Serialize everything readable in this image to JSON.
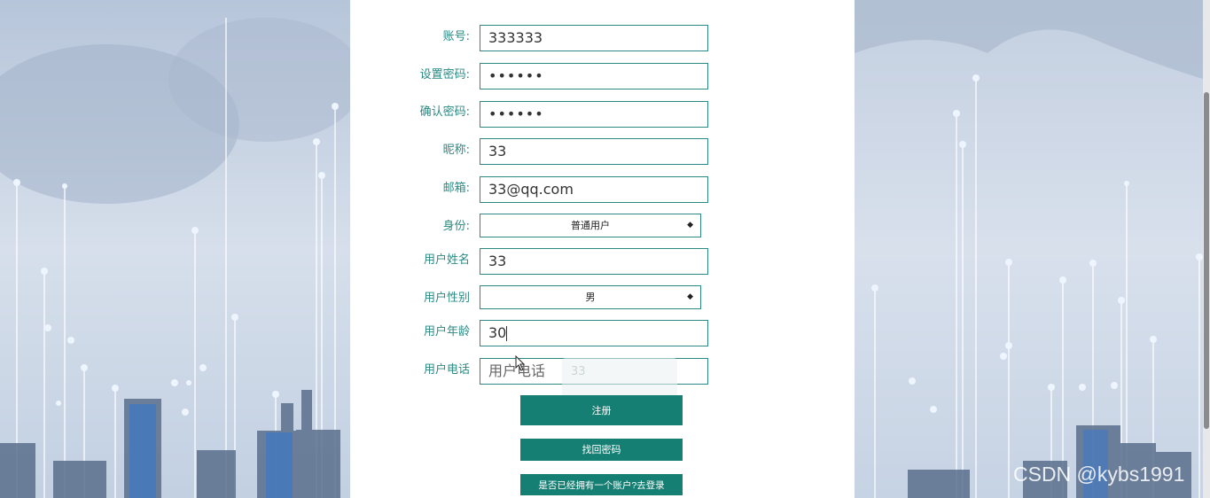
{
  "form": {
    "account_label": "账号:",
    "account_value": "333333",
    "set_password_label": "设置密码:",
    "set_password_value": "••••••",
    "confirm_password_label": "确认密码:",
    "confirm_password_value": "••••••",
    "nickname_label": "昵称:",
    "nickname_value": "33",
    "email_label": "邮箱:",
    "email_value": "33@qq.com",
    "identity_label": "身份:",
    "identity_value": "普通用户",
    "name_label": "用户姓名",
    "name_value": "33",
    "gender_label": "用户性别",
    "gender_value": "男",
    "age_label": "用户年龄",
    "age_value": "30",
    "phone_label": "用户电话",
    "phone_placeholder": "用户电话",
    "autofill_hint": "33"
  },
  "buttons": {
    "register": "注册",
    "recover_password": "找回密码",
    "go_login": "是否已经拥有一个账户?去登录"
  },
  "watermark": "CSDN @kybs1991",
  "colors": {
    "accent": "#2a8a83",
    "button": "#167f73"
  }
}
